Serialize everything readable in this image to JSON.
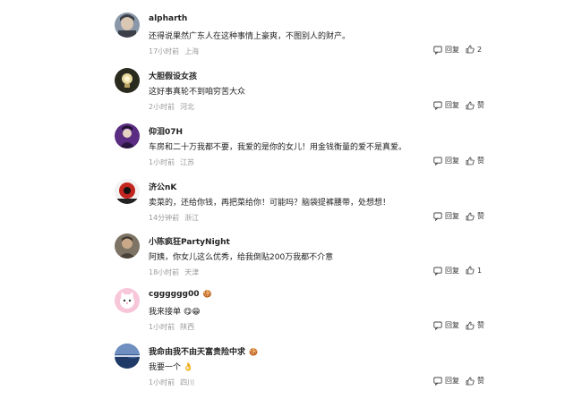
{
  "comments": [
    {
      "name": "alpharth",
      "name_emoji": "",
      "text": "还得说果然广东人在这种事情上豪爽，不图别人的财产。",
      "time": "17小时前",
      "location": "上海",
      "reply_label": "回复",
      "like_label": "2",
      "avatar_icon": "anime-portrait-avatar-icon",
      "colors": {
        "bg": "#8a97a8",
        "fg": "#3b3f48"
      }
    },
    {
      "name": "大胆假设女孩",
      "name_emoji": "",
      "text": "这好事真轮不到咱穷苦大众",
      "time": "2小时前",
      "location": "河北",
      "reply_label": "回复",
      "like_label": "赞",
      "avatar_icon": "lightbulb-avatar-icon",
      "colors": {
        "bg": "#2a2a1e",
        "fg": "#e8d9a0"
      }
    },
    {
      "name": "仰泪07H",
      "name_emoji": "",
      "text": "车房和二十万我都不要，我爱的是你的女儿！用金钱衡量的爱不是真爱。",
      "time": "1小时前",
      "location": "江苏",
      "reply_label": "回复",
      "like_label": "赞",
      "avatar_icon": "purple-figure-avatar-icon",
      "colors": {
        "bg": "#5a2d82",
        "fg": "#e6d2c2"
      }
    },
    {
      "name": "济公nK",
      "name_emoji": "",
      "text": "卖菜的，还给你钱，再把菜给你！可能吗？脑袋提裤腰带，处想想！",
      "time": "14分钟前",
      "location": "浙江",
      "reply_label": "回复",
      "like_label": "赞",
      "avatar_icon": "red-sun-avatar-icon",
      "colors": {
        "bg": "#f2f2f2",
        "fg": "#c2241f"
      }
    },
    {
      "name": "小陈疯狂PartyNight",
      "name_emoji": "",
      "text": "阿姨，你女儿这么优秀，给我倒贴200万我都不介意",
      "time": "18小时前",
      "location": "天津",
      "reply_label": "回复",
      "like_label": "1",
      "avatar_icon": "man-portrait-avatar-icon",
      "colors": {
        "bg": "#7d7466",
        "fg": "#3a332b"
      }
    },
    {
      "name": "cgggggg00",
      "name_emoji": "🍪",
      "text": "我来接单 😋😁",
      "time": "1小时前",
      "location": "陕西",
      "reply_label": "回复",
      "like_label": "赞",
      "avatar_icon": "pink-cat-avatar-icon",
      "colors": {
        "bg": "#f7c6d9",
        "fg": "#ffffff"
      }
    },
    {
      "name": "我命由我不由天富贵险中求",
      "name_emoji": "🍪",
      "text": "我要一个 👌",
      "time": "1小时前",
      "location": "四川",
      "reply_label": "回复",
      "like_label": "赞",
      "avatar_icon": "landscape-avatar-icon",
      "colors": {
        "bg": "#3a5c8f",
        "fg": "#cdd9ea"
      }
    }
  ]
}
